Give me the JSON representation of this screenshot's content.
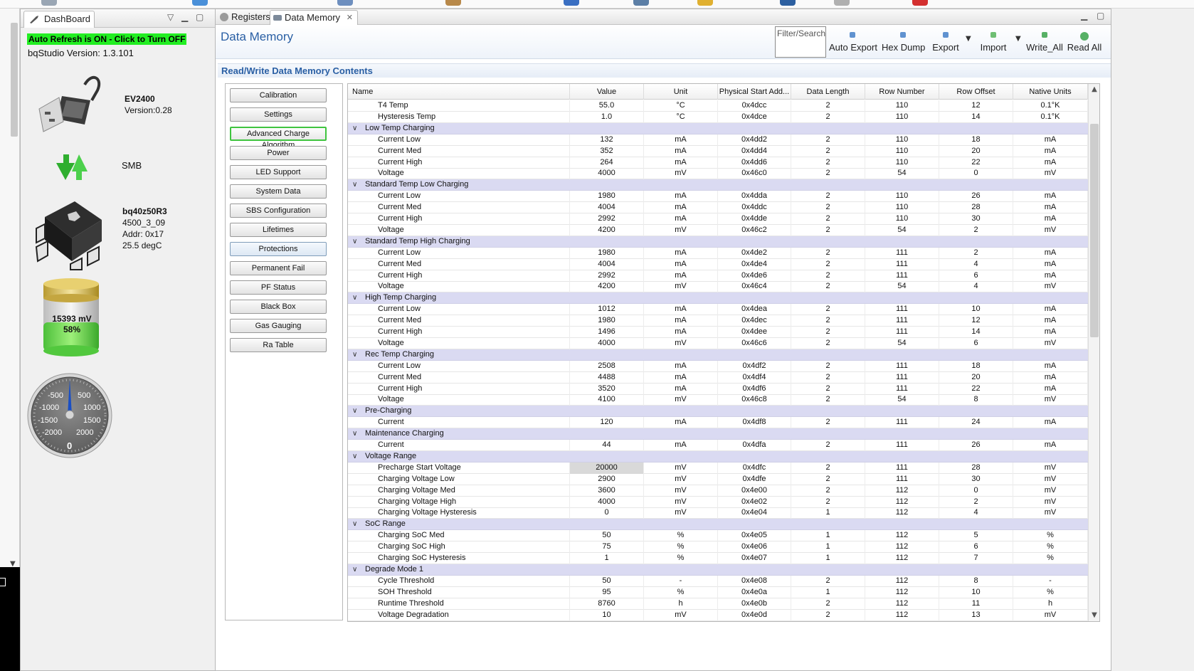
{
  "dashboard": {
    "tab_label": "DashBoard",
    "auto_refresh": "Auto Refresh is ON - Click to Turn OFF",
    "version_text": "bqStudio Version:  1.3.101",
    "adapter_name": "EV2400",
    "adapter_version": "Version:0.28",
    "bus": "SMB",
    "device_name": "bq40z50R3",
    "firmware": "4500_3_09",
    "address": "Addr: 0x17",
    "temperature": "25.5 degC",
    "battery_voltage": "15393 mV",
    "battery_soc": "58%",
    "gauge_labels": {
      "m500": "-500",
      "p500": "500",
      "m1000": "-1000",
      "p1000": "1000",
      "m1500": "-1500",
      "p1500": "1500",
      "m2000": "-2000",
      "p2000": "2000",
      "zero": "0"
    }
  },
  "tabs": {
    "registers": "Registers",
    "data_memory": "Data Memory"
  },
  "header": {
    "title": "Data Memory",
    "filter_label": "Filter/Search",
    "section_title": "Read/Write Data Memory Contents"
  },
  "toolbar": {
    "auto_export": "Auto Export",
    "hex_dump": "Hex Dump",
    "export": "Export",
    "import": "Import",
    "write_all": "Write_All",
    "read_all": "Read All"
  },
  "categories": [
    "Calibration",
    "Settings",
    "Advanced Charge Algorithm",
    "Power",
    "LED Support",
    "System Data",
    "SBS Configuration",
    "Lifetimes",
    "Protections",
    "Permanent Fail",
    "PF Status",
    "Black Box",
    "Gas Gauging",
    "Ra Table"
  ],
  "columns": [
    "Name",
    "Value",
    "Unit",
    "Physical Start Add...",
    "Data Length",
    "Row Number",
    "Row Offset",
    "Native Units"
  ],
  "rows": [
    {
      "type": "item",
      "cells": [
        "T4 Temp",
        "55.0",
        "°C",
        "0x4dcc",
        "2",
        "110",
        "12",
        "0.1°K"
      ]
    },
    {
      "type": "item",
      "cells": [
        "Hysteresis Temp",
        "1.0",
        "°C",
        "0x4dce",
        "2",
        "110",
        "14",
        "0.1°K"
      ]
    },
    {
      "type": "group",
      "label": "Low Temp Charging"
    },
    {
      "type": "item",
      "cells": [
        "Current Low",
        "132",
        "mA",
        "0x4dd2",
        "2",
        "110",
        "18",
        "mA"
      ]
    },
    {
      "type": "item",
      "cells": [
        "Current Med",
        "352",
        "mA",
        "0x4dd4",
        "2",
        "110",
        "20",
        "mA"
      ]
    },
    {
      "type": "item",
      "cells": [
        "Current High",
        "264",
        "mA",
        "0x4dd6",
        "2",
        "110",
        "22",
        "mA"
      ]
    },
    {
      "type": "item",
      "cells": [
        "Voltage",
        "4000",
        "mV",
        "0x46c0",
        "2",
        "54",
        "0",
        "mV"
      ]
    },
    {
      "type": "group",
      "label": "Standard Temp Low Charging"
    },
    {
      "type": "item",
      "cells": [
        "Current Low",
        "1980",
        "mA",
        "0x4dda",
        "2",
        "110",
        "26",
        "mA"
      ]
    },
    {
      "type": "item",
      "cells": [
        "Current Med",
        "4004",
        "mA",
        "0x4ddc",
        "2",
        "110",
        "28",
        "mA"
      ]
    },
    {
      "type": "item",
      "cells": [
        "Current High",
        "2992",
        "mA",
        "0x4dde",
        "2",
        "110",
        "30",
        "mA"
      ]
    },
    {
      "type": "item",
      "cells": [
        "Voltage",
        "4200",
        "mV",
        "0x46c2",
        "2",
        "54",
        "2",
        "mV"
      ]
    },
    {
      "type": "group",
      "label": "Standard Temp High Charging"
    },
    {
      "type": "item",
      "cells": [
        "Current Low",
        "1980",
        "mA",
        "0x4de2",
        "2",
        "111",
        "2",
        "mA"
      ]
    },
    {
      "type": "item",
      "cells": [
        "Current Med",
        "4004",
        "mA",
        "0x4de4",
        "2",
        "111",
        "4",
        "mA"
      ]
    },
    {
      "type": "item",
      "cells": [
        "Current High",
        "2992",
        "mA",
        "0x4de6",
        "2",
        "111",
        "6",
        "mA"
      ]
    },
    {
      "type": "item",
      "cells": [
        "Voltage",
        "4200",
        "mV",
        "0x46c4",
        "2",
        "54",
        "4",
        "mV"
      ]
    },
    {
      "type": "group",
      "label": "High Temp Charging"
    },
    {
      "type": "item",
      "cells": [
        "Current Low",
        "1012",
        "mA",
        "0x4dea",
        "2",
        "111",
        "10",
        "mA"
      ]
    },
    {
      "type": "item",
      "cells": [
        "Current Med",
        "1980",
        "mA",
        "0x4dec",
        "2",
        "111",
        "12",
        "mA"
      ]
    },
    {
      "type": "item",
      "cells": [
        "Current High",
        "1496",
        "mA",
        "0x4dee",
        "2",
        "111",
        "14",
        "mA"
      ]
    },
    {
      "type": "item",
      "cells": [
        "Voltage",
        "4000",
        "mV",
        "0x46c6",
        "2",
        "54",
        "6",
        "mV"
      ]
    },
    {
      "type": "group",
      "label": "Rec Temp Charging"
    },
    {
      "type": "item",
      "cells": [
        "Current Low",
        "2508",
        "mA",
        "0x4df2",
        "2",
        "111",
        "18",
        "mA"
      ]
    },
    {
      "type": "item",
      "cells": [
        "Current Med",
        "4488",
        "mA",
        "0x4df4",
        "2",
        "111",
        "20",
        "mA"
      ]
    },
    {
      "type": "item",
      "cells": [
        "Current High",
        "3520",
        "mA",
        "0x4df6",
        "2",
        "111",
        "22",
        "mA"
      ]
    },
    {
      "type": "item",
      "cells": [
        "Voltage",
        "4100",
        "mV",
        "0x46c8",
        "2",
        "54",
        "8",
        "mV"
      ]
    },
    {
      "type": "group",
      "label": "Pre-Charging"
    },
    {
      "type": "item",
      "cells": [
        "Current",
        "120",
        "mA",
        "0x4df8",
        "2",
        "111",
        "24",
        "mA"
      ]
    },
    {
      "type": "group",
      "label": "Maintenance Charging"
    },
    {
      "type": "item",
      "cells": [
        "Current",
        "44",
        "mA",
        "0x4dfa",
        "2",
        "111",
        "26",
        "mA"
      ]
    },
    {
      "type": "group",
      "label": "Voltage Range"
    },
    {
      "type": "item",
      "selected": true,
      "cells": [
        "Precharge Start Voltage",
        "20000",
        "mV",
        "0x4dfc",
        "2",
        "111",
        "28",
        "mV"
      ]
    },
    {
      "type": "item",
      "cells": [
        "Charging Voltage Low",
        "2900",
        "mV",
        "0x4dfe",
        "2",
        "111",
        "30",
        "mV"
      ]
    },
    {
      "type": "item",
      "cells": [
        "Charging Voltage Med",
        "3600",
        "mV",
        "0x4e00",
        "2",
        "112",
        "0",
        "mV"
      ]
    },
    {
      "type": "item",
      "cells": [
        "Charging Voltage High",
        "4000",
        "mV",
        "0x4e02",
        "2",
        "112",
        "2",
        "mV"
      ]
    },
    {
      "type": "item",
      "cells": [
        "Charging Voltage Hysteresis",
        "0",
        "mV",
        "0x4e04",
        "1",
        "112",
        "4",
        "mV"
      ]
    },
    {
      "type": "group",
      "label": "SoC Range"
    },
    {
      "type": "item",
      "cells": [
        "Charging SoC Med",
        "50",
        "%",
        "0x4e05",
        "1",
        "112",
        "5",
        "%"
      ]
    },
    {
      "type": "item",
      "cells": [
        "Charging SoC High",
        "75",
        "%",
        "0x4e06",
        "1",
        "112",
        "6",
        "%"
      ]
    },
    {
      "type": "item",
      "cells": [
        "Charging SoC Hysteresis",
        "1",
        "%",
        "0x4e07",
        "1",
        "112",
        "7",
        "%"
      ]
    },
    {
      "type": "group",
      "label": "Degrade Mode 1"
    },
    {
      "type": "item",
      "cells": [
        "Cycle Threshold",
        "50",
        "-",
        "0x4e08",
        "2",
        "112",
        "8",
        "-"
      ]
    },
    {
      "type": "item",
      "cells": [
        "SOH Threshold",
        "95",
        "%",
        "0x4e0a",
        "1",
        "112",
        "10",
        "%"
      ]
    },
    {
      "type": "item",
      "cells": [
        "Runtime Threshold",
        "8760",
        "h",
        "0x4e0b",
        "2",
        "112",
        "11",
        "h"
      ]
    },
    {
      "type": "item",
      "cells": [
        "Voltage Degradation",
        "10",
        "mV",
        "0x4e0d",
        "2",
        "112",
        "13",
        "mV"
      ]
    }
  ],
  "colors": {
    "auto_refresh_bg": "#22ee22",
    "title_blue": "#2a5fa4",
    "group_row_bg": "#dadaf2",
    "active_category_border": "#3fc43f"
  }
}
